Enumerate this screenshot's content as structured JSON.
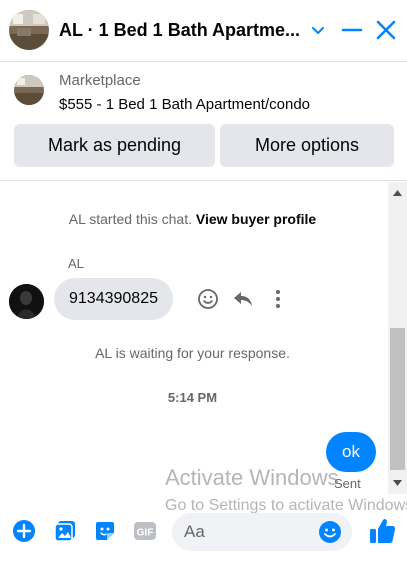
{
  "header": {
    "title": "AL · 1 Bed 1 Bath Apartme...",
    "icons": [
      "listing-avatar",
      "chevron-down-icon",
      "minimize-icon",
      "close-icon"
    ]
  },
  "marketplace": {
    "label": "Marketplace",
    "listing": "$555 - 1 Bed 1 Bath Apartment/condo",
    "buttons": {
      "mark_pending": "Mark as pending",
      "more_options": "More options"
    }
  },
  "chat": {
    "started": {
      "text": "AL started this chat.",
      "link": "View buyer profile"
    },
    "sender_name": "AL",
    "incoming_message": "9134390825",
    "waiting_text": "AL is waiting for your response.",
    "timestamp": "5:14 PM",
    "outgoing_message": "ok",
    "outgoing_status": "Sent"
  },
  "watermark": {
    "line1": "Activate Windows",
    "line2": "Go to Settings to activate Windows."
  },
  "composer": {
    "placeholder": "Aa",
    "icons": [
      "plus-icon",
      "photo-icon",
      "sticker-icon",
      "gif-icon",
      "emoji-icon",
      "thumbs-up-icon"
    ]
  },
  "colors": {
    "accent": "#0084ff",
    "bubble_gray": "#e4e6eb",
    "secondary_text": "#65676b"
  }
}
